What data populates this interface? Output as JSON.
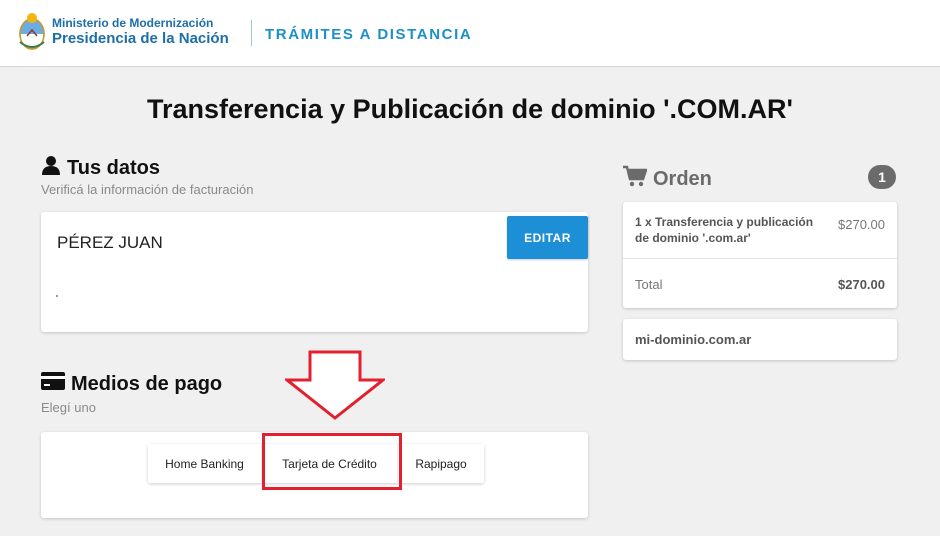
{
  "header": {
    "ministry_line1": "Ministerio de Modernización",
    "ministry_line2": "Presidencia de la Nación",
    "brand": "TRÁMITES A DISTANCIA"
  },
  "page": {
    "title": "Transferencia y Publicación de dominio '.COM.AR'"
  },
  "tus_datos": {
    "title": "Tus datos",
    "subtitle": "Verificá la información de facturación",
    "name": "PÉREZ JUAN",
    "edit_label": "EDITAR",
    "icon": "user-icon"
  },
  "medios_pago": {
    "title": "Medios de pago",
    "subtitle": "Elegí uno",
    "icon": "credit-card-icon",
    "options": [
      "Home Banking",
      "Tarjeta de Crédito",
      "Rapipago"
    ]
  },
  "orden": {
    "title": "Orden",
    "icon": "cart-icon",
    "count": "1",
    "item_label": "1 x Transferencia y publicación de dominio '.com.ar'",
    "item_price": "$270.00",
    "total_label": "Total",
    "total_value": "$270.00",
    "domain": "mi-dominio.com.ar"
  },
  "colors": {
    "accent": "#1d8fd6",
    "highlight": "#e2202e",
    "brand_blue": "#1d6fa7"
  }
}
